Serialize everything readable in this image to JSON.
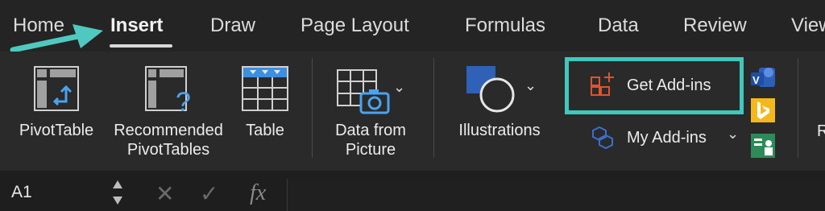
{
  "tabs": [
    {
      "label": "Home",
      "active": false
    },
    {
      "label": "Insert",
      "active": true
    },
    {
      "label": "Draw",
      "active": false
    },
    {
      "label": "Page Layout",
      "active": false
    },
    {
      "label": "Formulas",
      "active": false
    },
    {
      "label": "Data",
      "active": false
    },
    {
      "label": "Review",
      "active": false
    },
    {
      "label": "View",
      "active": false
    }
  ],
  "ribbon": {
    "pivottable": "PivotTable",
    "recommended_line1": "Recommended",
    "recommended_line2": "PivotTables",
    "table": "Table",
    "data_from_line1": "Data from",
    "data_from_line2": "Picture",
    "illustrations": "Illustrations",
    "get_addins": "Get Add-ins",
    "my_addins": "My Add-ins",
    "cut_off": "R"
  },
  "formula_bar": {
    "cell_ref": "A1",
    "cancel_glyph": "✕",
    "confirm_glyph": "✓",
    "fx_label": "fx"
  },
  "colors": {
    "highlight": "#40c8bd",
    "arrow": "#4fc9c0",
    "addins_icon": "#e0532f",
    "excel_blue": "#2f62b6"
  }
}
